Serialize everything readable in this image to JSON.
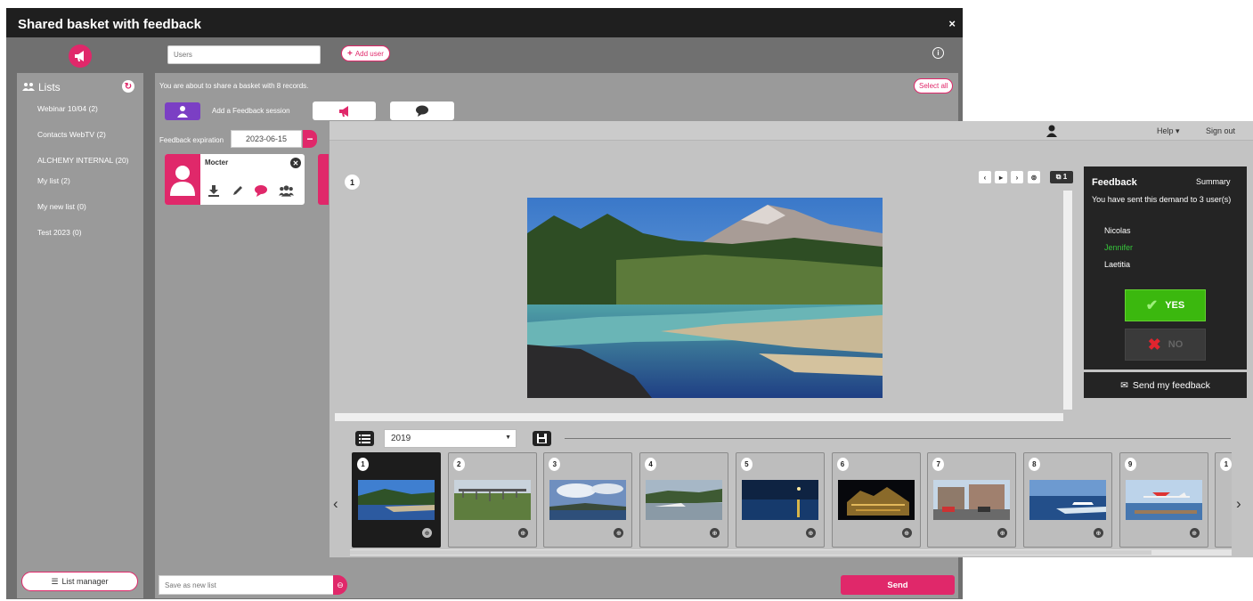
{
  "back_window": {
    "title": "Shared basket with feedback",
    "close": "×",
    "users_placeholder": "Users",
    "add_user_label": "Add user",
    "info": "i",
    "lists": {
      "header": "Lists",
      "items": [
        {
          "label": "Webinar 10/04 (2)"
        },
        {
          "label": "Contacts WebTV (2)"
        },
        {
          "label": "ALCHEMY INTERNAL (20)"
        },
        {
          "label": "My list (2)"
        },
        {
          "label": "My new list (0)"
        },
        {
          "label": "Test 2023 (0)"
        }
      ],
      "manager_label": "List manager"
    },
    "main": {
      "share_message": "You are about to share a basket with 8 records.",
      "select_all": "Select all",
      "add_feedback_label": "Add a Feedback session",
      "expiration_label": "Feedback expiration",
      "expiration_date": "2023-06-15",
      "minus": "−",
      "user_card_name": "Mocter",
      "save_list_placeholder": "Save as new list",
      "send_label": "Send"
    }
  },
  "front_window": {
    "topbar": {
      "help": "Help ▾",
      "signout": "Sign out"
    },
    "viewer": {
      "record_number": "1",
      "nav": [
        "‹",
        "▸",
        "›",
        "⊚",
        "⧉ 1"
      ]
    },
    "feedback": {
      "title": "Feedback",
      "summary": "Summary",
      "message": "You have sent this demand to 3 user(s)",
      "users": [
        {
          "name": "Nicolas",
          "color": "#ffffff"
        },
        {
          "name": "Jennifer",
          "color": "#35c43a"
        },
        {
          "name": "Laetitia",
          "color": "#ffffff"
        }
      ],
      "yes_label": "YES",
      "no_label": "NO",
      "send_label": "Send my feedback"
    },
    "toolbar": {
      "year": "2019"
    },
    "thumbnails": [
      {
        "num": "1",
        "scene": "lake"
      },
      {
        "num": "2",
        "scene": "bridge"
      },
      {
        "num": "3",
        "scene": "clouds"
      },
      {
        "num": "4",
        "scene": "coast"
      },
      {
        "num": "5",
        "scene": "night-sea"
      },
      {
        "num": "6",
        "scene": "night-building"
      },
      {
        "num": "7",
        "scene": "street"
      },
      {
        "num": "8",
        "scene": "boat"
      },
      {
        "num": "9",
        "scene": "seaplane"
      },
      {
        "num": "1",
        "scene": "partial"
      }
    ]
  },
  "colors": {
    "accent": "#e0286a",
    "purple": "#7b3fc4",
    "yes_green": "#3bb80e",
    "dark": "#242424"
  }
}
